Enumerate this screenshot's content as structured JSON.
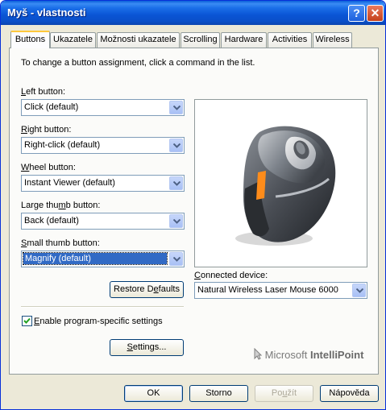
{
  "window": {
    "title": "Myš - vlastnosti",
    "help_glyph": "?",
    "close_glyph": "✕"
  },
  "tabs": [
    {
      "label": "Buttons",
      "active": true
    },
    {
      "label": "Ukazatele"
    },
    {
      "label": "Možnosti ukazatele"
    },
    {
      "label": "Scrolling"
    },
    {
      "label": "Hardware"
    },
    {
      "label": "Activities"
    },
    {
      "label": "Wireless"
    }
  ],
  "buttons_tab": {
    "instruction": "To change a button assignment, click a command in the list.",
    "left": {
      "label_key": "L",
      "label_rest": "eft button:",
      "value": "Click (default)"
    },
    "right": {
      "label_key": "R",
      "label_rest": "ight button:",
      "value": "Right-click (default)"
    },
    "wheel": {
      "label_key": "W",
      "label_rest": "heel button:",
      "value": "Instant Viewer (default)"
    },
    "large_thumb": {
      "label_pre": "Large thu",
      "label_key": "m",
      "label_rest": "b button:",
      "value": "Back (default)"
    },
    "small_thumb": {
      "label_key": "S",
      "label_rest": "mall thumb button:",
      "value": "Magnify (default)"
    },
    "restore_defaults": {
      "pre": "Restore D",
      "key": "e",
      "rest": "faults"
    },
    "enable_program": {
      "key": "E",
      "rest": "nable program-specific settings",
      "checked": true
    },
    "settings": {
      "key": "S",
      "rest": "ettings..."
    },
    "connected_device": {
      "label_key": "C",
      "label_rest": "onnected device:",
      "value": "Natural Wireless Laser Mouse 6000"
    },
    "brand": {
      "word1": "Microsoft",
      "word2": "IntelliPoint"
    }
  },
  "footer": {
    "ok": "OK",
    "cancel": "Storno",
    "apply": {
      "pre": "Po",
      "key": "u",
      "rest": "žít",
      "disabled": true
    },
    "help": "Nápověda"
  },
  "colors": {
    "accent_tab": "#ffc83c",
    "selection": "#316ac5",
    "mouse_accent": "#ff8c1a"
  }
}
